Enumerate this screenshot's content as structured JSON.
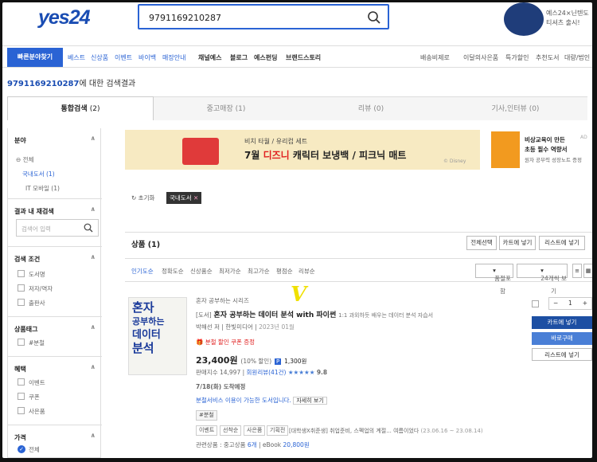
{
  "header": {
    "logo": "yes24",
    "search_value": "9791169210287",
    "promo": "예스24×닌텐도 티셔츠 출시!"
  },
  "nav": {
    "quick": "빠른분야찾기",
    "items": [
      "베스트",
      "신상품",
      "이벤트",
      "바이백",
      "매장안내"
    ],
    "items2": [
      "채널예스",
      "블로그",
      "예스펀딩",
      "브랜드스토리"
    ],
    "right": [
      "배송비제로",
      "이달의사은품",
      "특가할인",
      "추천도서",
      "대량/법인"
    ]
  },
  "result": {
    "query": "9791169210287",
    "suffix": "에 대한 검색결과"
  },
  "tabs": [
    {
      "label": "통합검색",
      "count": "(2)"
    },
    {
      "label": "중고매장",
      "count": "(1)"
    },
    {
      "label": "리뷰",
      "count": "(0)"
    },
    {
      "label": "기사,인터뷰",
      "count": "(0)"
    }
  ],
  "sidebar": {
    "field_title": "분야",
    "field_items": [
      "전체",
      "국내도서",
      "IT 모바일"
    ],
    "field_counts": [
      "",
      "(1)",
      "(1)"
    ],
    "research_title": "결과 내 재검색",
    "research_placeholder": "검색어 입력",
    "cond_title": "검색 조건",
    "cond_items": [
      "도서명",
      "저자/역자",
      "출판사"
    ],
    "tag_title": "상품태그",
    "tag_items": [
      "#분철"
    ],
    "benefit_title": "혜택",
    "benefit_items": [
      "이벤트",
      "쿠폰",
      "사은품"
    ],
    "price_title": "가격",
    "price_items": [
      "전체"
    ]
  },
  "banner": {
    "line1": "비치 타월 / 유리컵 세트",
    "line2a": "7월 ",
    "line2b": "디즈니",
    "line2c": " 캐릭터 보냉백 / 피크닉 매트",
    "brand": "© Disney",
    "right1": "비상교육이 만든",
    "right2": "초등 필수 역량서",
    "right3": "원자 공부력 성장노트 증정",
    "ad": "AD"
  },
  "filter": {
    "reset": "초기화",
    "chip": "국내도서"
  },
  "products": {
    "label": "상품",
    "count": "(1)",
    "select_all": "전체선택",
    "cart": "카트에 넣기",
    "wishlist": "리스트에 넣기"
  },
  "sort": {
    "options": [
      "인기도순",
      "정확도순",
      "신상품순",
      "최저가순",
      "최고가순",
      "평점순",
      "리뷰순"
    ],
    "view_select": "품절포함",
    "per_page": "24개씩 보기"
  },
  "book": {
    "series": "혼자 공부하는 시리즈",
    "type": "[도서]",
    "title": "혼자 공부하는 데이터 분석 with 파이썬",
    "subtitle": "1:1 과외하듯 배우는 데이터 분석 자습서",
    "author": "박해선 저",
    "publisher": "한빛미디어",
    "date": "2023년 01월",
    "coupon": "분철 할인 쿠폰 증정",
    "price": "23,400원",
    "discount": "(10% 할인)",
    "point": "1,300원",
    "sales": "판매지수 14,997",
    "reviews": "회원리뷰(41건)",
    "rating": "9.8",
    "delivery": "7/18(화) 도착예정",
    "service": "분철서비스 이용이 가능한 도서입니다.",
    "detail": "자세히 보기",
    "tag": "#분철",
    "event_tags": [
      "이벤트",
      "선착순",
      "사은품",
      "기획전"
    ],
    "event_text": "[대학생X취준생] 취업준비, 스펙업의 계절... 여름이었다",
    "event_date": "(23.06.16 ~ 23.08.14)",
    "related": "관련상품 : 중고상품",
    "related_count": "6개",
    "ebook": "eBook",
    "ebook_price": "20,800원",
    "cover_text": [
      "혼자",
      "공부하는",
      "데이터",
      "분석"
    ],
    "qty": "1",
    "add_cart": "카트에 넣기",
    "buy_now": "바로구매",
    "add_list": "리스트에 넣기"
  },
  "annotation": "V",
  "colors": {
    "brand": "#2a63d4",
    "accent": "#e02020",
    "star": "#4a7fd6"
  }
}
